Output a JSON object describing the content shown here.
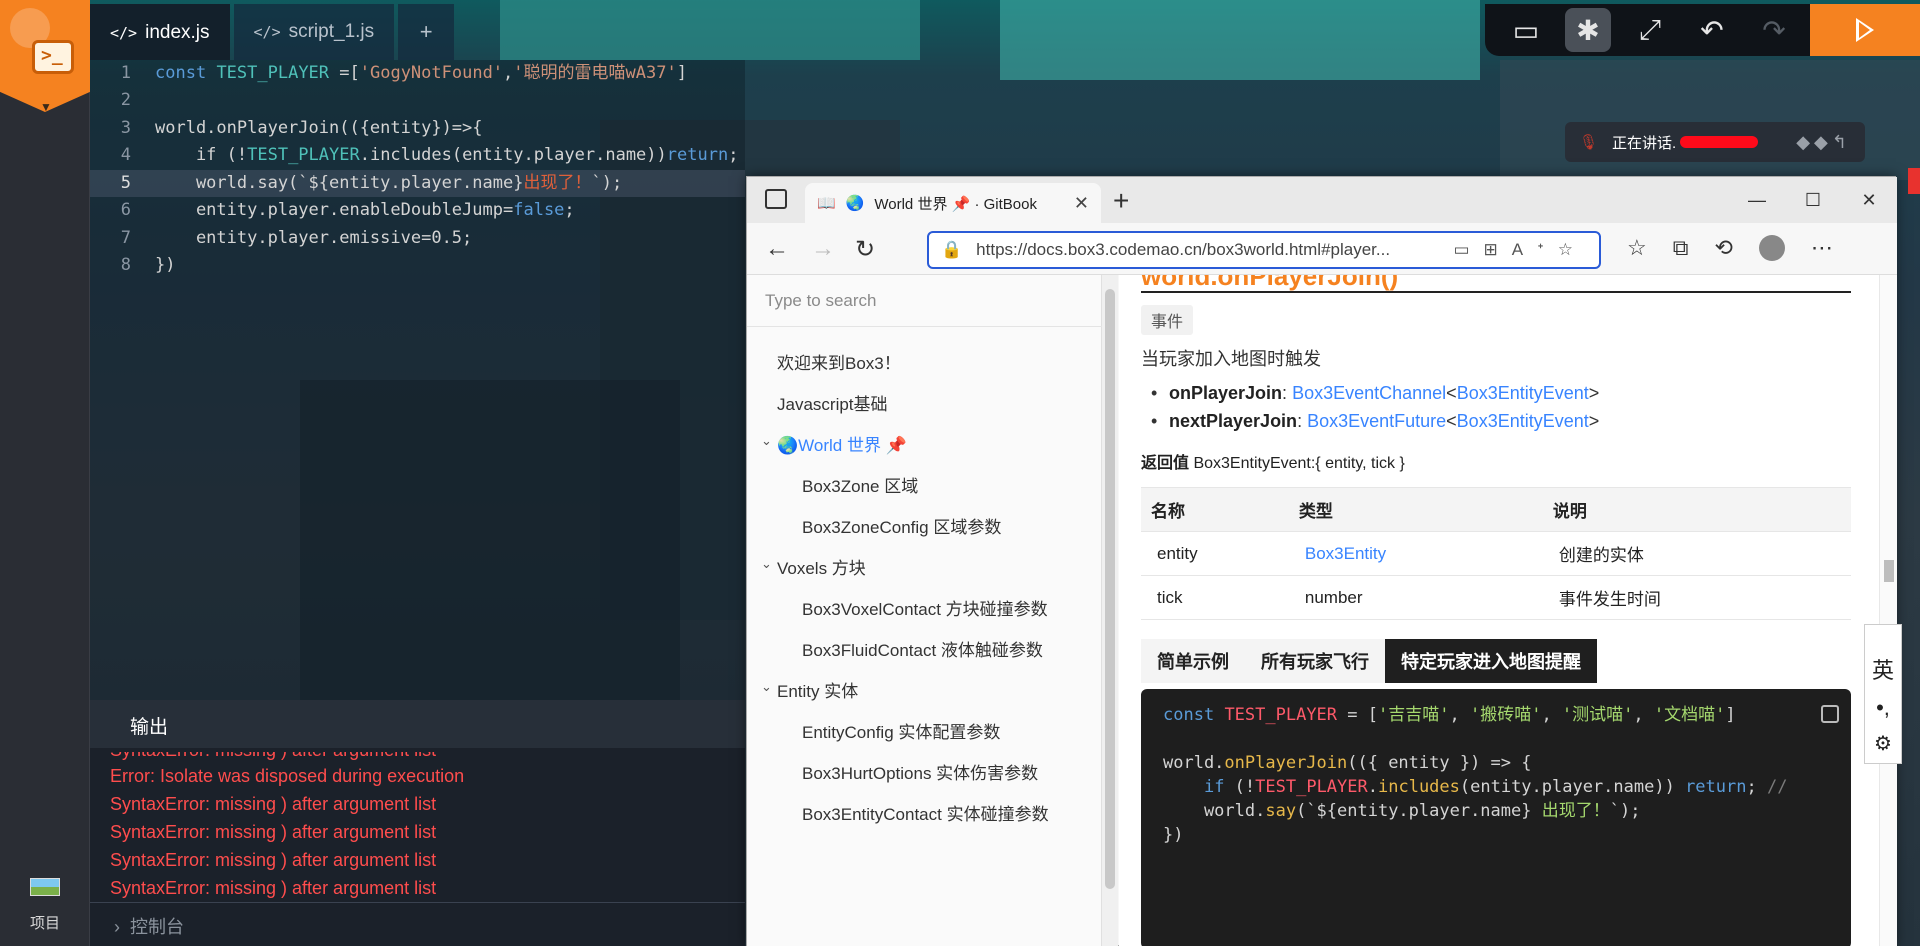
{
  "editor": {
    "tabs": [
      {
        "icon": "</>",
        "label": "index.js"
      },
      {
        "icon": "</>",
        "label": "script_1.js"
      },
      {
        "label": "+"
      }
    ],
    "lines": [
      {
        "n": "1"
      },
      {
        "n": "2"
      },
      {
        "n": "3"
      },
      {
        "n": "4"
      },
      {
        "n": "5"
      },
      {
        "n": "6"
      },
      {
        "n": "7"
      },
      {
        "n": "8"
      }
    ],
    "code": {
      "l1_kw": "const",
      "l1_cst": "TEST_PLAYER",
      "l1_op": " =[",
      "l1_s1": "'GogyNotFound'",
      "l1_comma": ",",
      "l1_s2": "'聪明的雷电喵wA37'",
      "l1_end": "]",
      "l3": "world.onPlayerJoin(({entity})=>{",
      "l4_a": "    if (!",
      "l4_cst": "TEST_PLAYER",
      "l4_b": ".includes(entity.player.name))",
      "l4_kw": "return",
      "l4_c": ";",
      "l5_a": "    world.say(`${entity.player.name}",
      "l5_cn": "出现了！",
      "l5_b": "`);",
      "l6_a": "    entity.player.enableDoubleJump=",
      "l6_kw": "false",
      "l6_b": ";",
      "l7": "    entity.player.emissive=0.5;",
      "l8": "})"
    }
  },
  "toolbar": {
    "icons": [
      "chat-icon",
      "bug-icon",
      "expand-icon",
      "undo-icon",
      "redo-icon"
    ],
    "run_icon": "play-icon"
  },
  "voice": {
    "label": "正在讲话."
  },
  "output": {
    "title": "输出",
    "lines": [
      "SyntaxError: missing ) after argument list",
      "Error: Isolate was disposed during execution",
      "SyntaxError: missing ) after argument list",
      "SyntaxError: missing ) after argument list",
      "SyntaxError: missing ) after argument list",
      "SyntaxError: missing ) after argument list"
    ],
    "console_label": "控制台"
  },
  "left_rail": {
    "project_label": "项目"
  },
  "browser": {
    "tab_title": "World 世界 📌 · GitBook",
    "url": "https://docs.box3.codemao.cn/box3world.html#player...",
    "sidebar": {
      "search_placeholder": "Type to search",
      "items": [
        "欢迎来到Box3！",
        "Javascript基础",
        "World 世界 📌",
        "Box3Zone 区域",
        "Box3ZoneConfig 区域参数",
        "Voxels 方块",
        "Box3VoxelContact 方块碰撞参数",
        "Box3FluidContact 液体触碰参数",
        "Entity 实体",
        "EntityConfig 实体配置参数",
        "Box3HurtOptions 实体伤害参数",
        "Box3EntityContact 实体碰撞参数"
      ]
    },
    "content": {
      "heading": "world.onPlayerJoin()",
      "tag": "事件",
      "desc": "当玩家加入地图时触发",
      "bullets": [
        {
          "name": "onPlayerJoin",
          "sep": ": ",
          "type": "Box3EventChannel",
          "lt": "<",
          "arg": "Box3EntityEvent",
          "gt": ">"
        },
        {
          "name": "nextPlayerJoin",
          "sep": ": ",
          "type": "Box3EventFuture",
          "lt": "<",
          "arg": "Box3EntityEvent",
          "gt": ">"
        }
      ],
      "return_label": "返回值",
      "return_value": " Box3EntityEvent:{ entity, tick }",
      "table": {
        "headers": [
          "名称",
          "类型",
          "说明"
        ],
        "rows": [
          [
            "entity",
            "Box3Entity",
            "创建的实体"
          ],
          [
            "tick",
            "number",
            "事件发生时间"
          ]
        ]
      },
      "example_tabs": [
        "简单示例",
        "所有玩家飞行",
        "特定玩家进入地图提醒"
      ],
      "code": {
        "c1_kw": "const",
        "c1_cst": "TEST_PLAYER",
        "c1_eq": " = [",
        "c1_s1": "'吉吉喵'",
        "c1_c1": ", ",
        "c1_s2": "'搬砖喵'",
        "c1_c2": ", ",
        "c1_s3": "'测试喵'",
        "c1_c3": ", ",
        "c1_s4": "'文档喵'",
        "c1_end": "]",
        "c3_a": "world.",
        "c3_fn": "onPlayerJoin",
        "c3_b": "(({ entity }) => {",
        "c4_a": "    ",
        "c4_kw": "if",
        "c4_b": " (!",
        "c4_cst": "TEST_PLAYER",
        "c4_c": ".",
        "c4_fn": "includes",
        "c4_d": "(entity.player.name)) ",
        "c4_kw2": "return",
        "c4_e": "; ",
        "c4_cmt": "//",
        "c5_a": "    world.",
        "c5_fn": "say",
        "c5_b": "(`${entity.player.name} ",
        "c5_str": "出现了！",
        "c5_c": "`);",
        "c6": "})"
      }
    }
  },
  "ime": {
    "lang": "英",
    "punct": "•,"
  }
}
